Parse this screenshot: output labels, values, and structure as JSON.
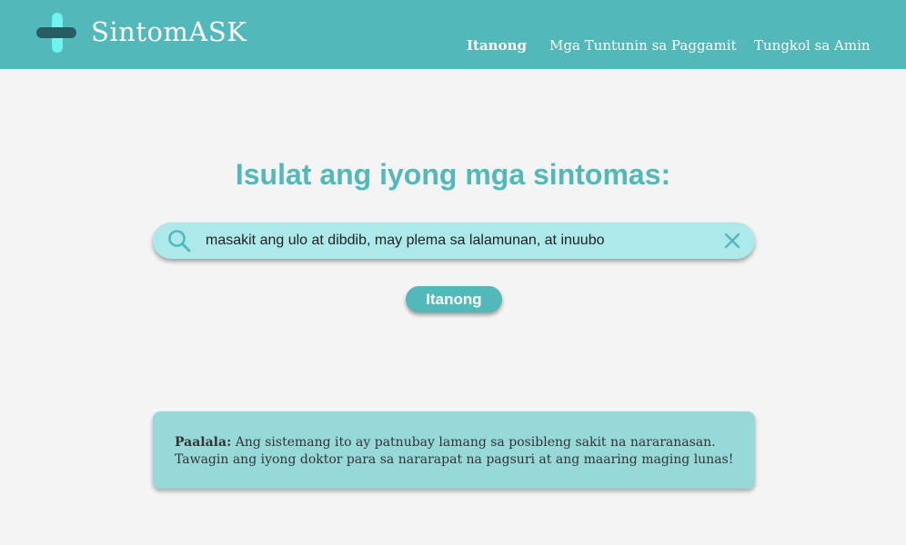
{
  "header": {
    "brand": "SintomASK",
    "nav": [
      {
        "label": "Itanong",
        "active": true
      },
      {
        "label": "Mga Tuntunin sa Paggamit",
        "active": false
      },
      {
        "label": "Tungkol sa Amin",
        "active": false
      }
    ],
    "colors": {
      "bar": "#52b8b9",
      "logo_vertical": "#6ff3f0",
      "logo_horizontal": "#255d63"
    }
  },
  "main": {
    "heading": "Isulat ang iyong mga sintomas:",
    "search": {
      "value": "masakit ang ulo at dibdib, may plema sa lalamunan, at inuubo",
      "icon": "search-icon",
      "clear_icon": "close-icon"
    },
    "submit_label": "Itanong"
  },
  "notice": {
    "label": "Paalala:",
    "line1": "Ang sistemang ito ay patnubay lamang sa posibleng sakit na nararanasan.",
    "line2": "Tawagin ang iyong doktor para sa nararapat na pagsuri at ang maaring maging lunas!"
  }
}
